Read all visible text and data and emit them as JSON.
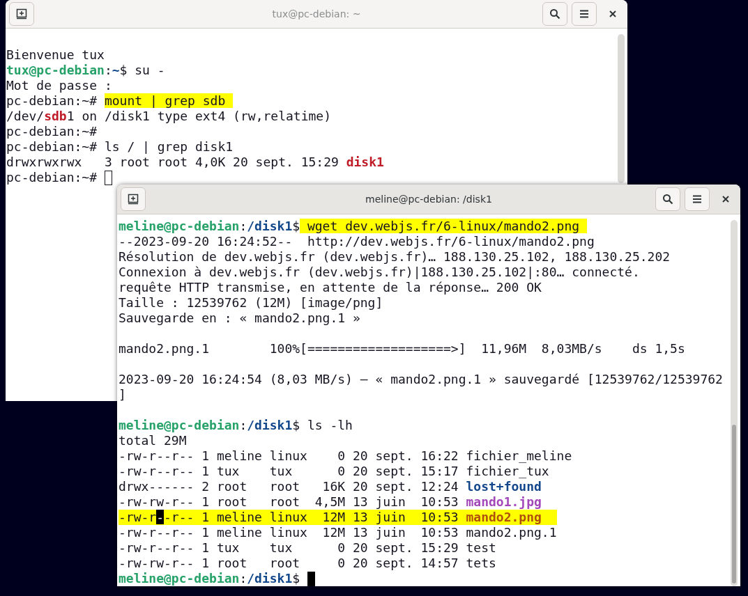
{
  "windows": [
    {
      "title": "tux@pc-debian: ~",
      "focused": false,
      "lines": [
        {
          "kind": "blank"
        },
        {
          "kind": "text",
          "segs": [
            {
              "kind": "plain",
              "text": "Bienvenue tux"
            }
          ]
        },
        {
          "kind": "text",
          "segs": [
            {
              "kind": "user",
              "text": "tux@pc-debian"
            },
            {
              "kind": "plain",
              "text": ":"
            },
            {
              "kind": "path",
              "text": "~"
            },
            {
              "kind": "plain",
              "text": "$ su -"
            }
          ]
        },
        {
          "kind": "text",
          "segs": [
            {
              "kind": "plain",
              "text": "Mot de passe :"
            }
          ]
        },
        {
          "kind": "text",
          "segs": [
            {
              "kind": "plain",
              "text": "pc-debian:~# "
            },
            {
              "kind": "marked",
              "text": "mount | grep sdb"
            }
          ]
        },
        {
          "kind": "text",
          "segs": [
            {
              "kind": "plain",
              "text": "/dev/"
            },
            {
              "kind": "red",
              "text": "sdb"
            },
            {
              "kind": "plain",
              "text": "1 on /disk1 type ext4 (rw,relatime)"
            }
          ]
        },
        {
          "kind": "text",
          "segs": [
            {
              "kind": "plain",
              "text": "pc-debian:~#"
            }
          ]
        },
        {
          "kind": "text",
          "segs": [
            {
              "kind": "plain",
              "text": "pc-debian:~# ls / | grep disk1"
            }
          ]
        },
        {
          "kind": "text",
          "segs": [
            {
              "kind": "plain",
              "text": "drwxrwxrwx   3 root root 4,0K 20 sept. 15:29 "
            },
            {
              "kind": "red",
              "text": "disk1"
            }
          ]
        },
        {
          "kind": "text",
          "segs": [
            {
              "kind": "plain",
              "text": "pc-debian:~# "
            }
          ]
        }
      ]
    },
    {
      "title": "meline@pc-debian: /disk1",
      "focused": true,
      "lines": [
        {
          "kind": "text",
          "segs": [
            {
              "kind": "user",
              "text": "meline@pc-debian"
            },
            {
              "kind": "plain",
              "text": ":"
            },
            {
              "kind": "path",
              "text": "/disk1"
            },
            {
              "kind": "plain",
              "text": "$"
            },
            {
              "kind": "marked",
              "text": " wget dev.webjs.fr/6-linux/mando2.png"
            }
          ]
        },
        {
          "kind": "text",
          "segs": [
            {
              "kind": "plain",
              "text": "--2023-09-20 16:24:52--  http://dev.webjs.fr/6-linux/mando2.png"
            }
          ]
        },
        {
          "kind": "text",
          "segs": [
            {
              "kind": "plain",
              "text": "Résolution de dev.webjs.fr (dev.webjs.fr)… 188.130.25.102, 188.130.25.202"
            }
          ]
        },
        {
          "kind": "text",
          "segs": [
            {
              "kind": "plain",
              "text": "Connexion à dev.webjs.fr (dev.webjs.fr)|188.130.25.102|:80… connecté."
            }
          ]
        },
        {
          "kind": "text",
          "segs": [
            {
              "kind": "plain",
              "text": "requête HTTP transmise, en attente de la réponse… 200 OK"
            }
          ]
        },
        {
          "kind": "text",
          "segs": [
            {
              "kind": "plain",
              "text": "Taille : 12539762 (12M) [image/png]"
            }
          ]
        },
        {
          "kind": "text",
          "segs": [
            {
              "kind": "plain",
              "text": "Sauvegarde en : « mando2.png.1 »"
            }
          ]
        },
        {
          "kind": "blank"
        },
        {
          "kind": "text",
          "segs": [
            {
              "kind": "plain",
              "text": "mando2.png.1        100%[===================>]  11,96M  8,03MB/s    ds 1,5s"
            }
          ]
        },
        {
          "kind": "blank"
        },
        {
          "kind": "text",
          "segs": [
            {
              "kind": "plain",
              "text": "2023-09-20 16:24:54 (8,03 MB/s) — « mando2.png.1 » sauvegardé [12539762/12539762"
            }
          ]
        },
        {
          "kind": "text",
          "segs": [
            {
              "kind": "plain",
              "text": "]"
            }
          ]
        },
        {
          "kind": "blank"
        },
        {
          "kind": "text",
          "segs": [
            {
              "kind": "user",
              "text": "meline@pc-debian"
            },
            {
              "kind": "plain",
              "text": ":"
            },
            {
              "kind": "path",
              "text": "/disk1"
            },
            {
              "kind": "plain",
              "text": "$ ls -lh"
            }
          ]
        },
        {
          "kind": "text",
          "segs": [
            {
              "kind": "plain",
              "text": "total 29M"
            }
          ]
        },
        {
          "kind": "text",
          "segs": [
            {
              "kind": "plain",
              "text": "-rw-r--r-- 1 meline linux    0 20 sept. 16:22 fichier_meline"
            }
          ]
        },
        {
          "kind": "text",
          "segs": [
            {
              "kind": "plain",
              "text": "-rw-r--r-- 1 tux    tux      0 20 sept. 15:17 fichier_tux"
            }
          ]
        },
        {
          "kind": "text",
          "segs": [
            {
              "kind": "plain",
              "text": "drwx------ 2 root   root   16K 20 sept. 12:24 "
            },
            {
              "kind": "dir",
              "text": "lost+found"
            }
          ]
        },
        {
          "kind": "text",
          "segs": [
            {
              "kind": "plain",
              "text": "-rw-rw-r-- 1 root   root  4,5M 13 juin  10:53 "
            },
            {
              "kind": "image",
              "text": "mando1.jpg"
            }
          ]
        },
        {
          "kind": "highlighted",
          "segs": [
            {
              "kind": "plain",
              "text": "-rw-r"
            },
            {
              "kind": "inverse",
              "text": "-"
            },
            {
              "kind": "plain",
              "text": "-r-- 1 meline linux  12M 13 juin  10:53 "
            },
            {
              "kind": "orange",
              "text": "mando2.png"
            }
          ]
        },
        {
          "kind": "text",
          "segs": [
            {
              "kind": "plain",
              "text": "-rw-r--r-- 1 meline linux  12M 13 juin  10:53 mando2.png.1"
            }
          ]
        },
        {
          "kind": "text",
          "segs": [
            {
              "kind": "plain",
              "text": "-rw-r--r-- 1 tux    tux      0 20 sept. 15:29 test"
            }
          ]
        },
        {
          "kind": "text",
          "segs": [
            {
              "kind": "plain",
              "text": "-rw-rw-r-- 1 root   root     0 20 sept. 14:57 tets"
            }
          ]
        },
        {
          "kind": "text",
          "segs": [
            {
              "kind": "user",
              "text": "meline@pc-debian"
            },
            {
              "kind": "plain",
              "text": ":"
            },
            {
              "kind": "path",
              "text": "/disk1"
            },
            {
              "kind": "plain",
              "text": "$ "
            }
          ]
        }
      ]
    }
  ]
}
